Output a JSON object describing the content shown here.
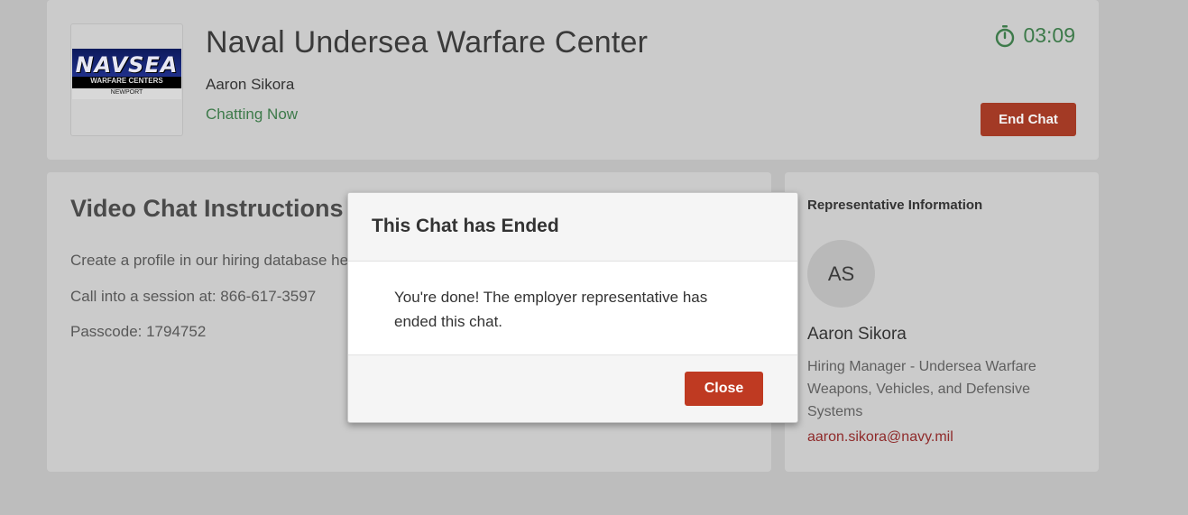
{
  "header": {
    "logo_text": "NAVSEA",
    "logo_subtext": "WARFARE CENTERS",
    "logo_location": "NEWPORT",
    "org_title": "Naval Undersea Warfare Center",
    "rep_name": "Aaron Sikora",
    "status": "Chatting Now",
    "timer": "03:09",
    "timer_icon": "stopwatch-icon",
    "end_chat_label": "End Chat"
  },
  "instructions": {
    "title": "Video Chat Instructions",
    "lines": [
      "Create a profile in our hiring database he",
      "Call into a session at: 866-617-3597",
      "Passcode: 1794752"
    ]
  },
  "representative": {
    "heading": "Representative Information",
    "initials": "AS",
    "name": "Aaron Sikora",
    "role": "Hiring Manager - Undersea Warfare Weapons, Vehicles, and Defensive Systems",
    "email": "aaron.sikora@navy.mil"
  },
  "modal": {
    "title": "This Chat has Ended",
    "body": "You're done! The employer representative has ended this chat.",
    "close_label": "Close"
  },
  "colors": {
    "accent_green": "#3d7a4a",
    "end_chat": "#a33a25",
    "close_button": "#bf3a22",
    "email_link": "#8f2a2a"
  }
}
